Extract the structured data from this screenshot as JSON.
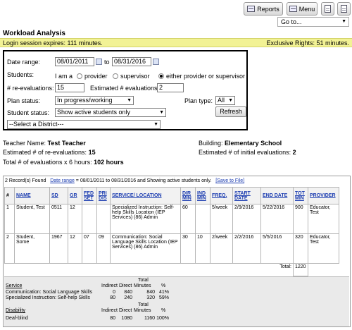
{
  "toolbar": {
    "reports_label": "Reports",
    "menu_label": "Menu",
    "goto_value": "Go to..."
  },
  "page_title": "Workload Analysis",
  "session": {
    "login_text": "Login session expires: 111 minutes.",
    "rights_text": "Exclusive Rights: 51 minutes."
  },
  "filters": {
    "date_range_label": "Date range:",
    "date_from": "08/01/2011",
    "to_label": "to",
    "date_to": "08/31/2016",
    "students_label": "Students:",
    "i_am_label": "I am a",
    "role_options": [
      "provider",
      "supervisor",
      "either provider or supervisor"
    ],
    "role_selected": "either provider or supervisor",
    "reevals_label": "# re-evaluations:",
    "reevals_value": "15",
    "est_evals_label": "Estimated # evaluations:",
    "est_evals_value": "2",
    "plan_status_label": "Plan status:",
    "plan_status_value": "In progress/working",
    "plan_type_label": "Plan type:",
    "plan_type_value": "All",
    "student_status_label": "Student status:",
    "student_status_value": "Show active students only",
    "refresh_label": "Refresh",
    "district_value": "--Select a District---"
  },
  "summary": {
    "teacher_label": "Teacher Name:",
    "teacher_value": "Test Teacher",
    "building_label": "Building:",
    "building_value": "Elementary School",
    "est_reevals_label": "Estimated # of re-evaluations:",
    "est_reevals_value": "15",
    "est_initial_label": "Estimated # of initial evaluations:",
    "est_initial_value": "2",
    "total_label": "Total # of evaluations x 6 hours:",
    "total_value": "102 hours"
  },
  "records": {
    "found_text": "2 Record(s) Found",
    "date_range_link": "Date range",
    "range_text": "= 08/01/2011 to 08/31/2016 and Showing active students only.",
    "save_link": "[Save to File]",
    "columns": [
      "#",
      "NAME",
      "SD",
      "GR",
      "FED SET",
      "PRI DIS",
      "SERVICE/ LOCATION",
      "DIR MIN",
      "IND MIN",
      "FREQ.",
      "START DATE",
      "END DATE",
      "TOT MIN",
      "PROVIDER"
    ],
    "rows": [
      [
        "1",
        "Student, Test",
        "0511",
        "12",
        "",
        "",
        "Specialized Instruction: Self-help Skills Location (IEP Services) (86) Admin",
        "60",
        "",
        "5/week",
        "2/9/2016",
        "5/22/2016",
        "900",
        "Educator, Test"
      ],
      [
        "2",
        "Student, Some",
        "1967",
        "12",
        "07",
        "09",
        "Communication: Social Language Skills Location (IEP Services) (86) Admin",
        "30",
        "10",
        "2/week",
        "2/2/2016",
        "5/5/2016",
        "320",
        "Educator, Test"
      ]
    ],
    "total_label": "Total:",
    "total_value": "1220"
  },
  "breakdown": {
    "service_header": "Service",
    "indirect_label": "Indirect",
    "direct_label": "Direct",
    "total_minutes_label": "Total Minutes",
    "pct_label": "%",
    "service_rows": [
      [
        "Communication: Social Language Skills",
        "0",
        "840",
        "840",
        "41%"
      ],
      [
        "Specialized Instruction: Self-help Skills",
        "80",
        "240",
        "320",
        "59%"
      ]
    ],
    "disability_header": "Disability",
    "disability_rows": [
      [
        "Deaf-blind",
        "80",
        "1080",
        "1160",
        "100%"
      ]
    ]
  }
}
